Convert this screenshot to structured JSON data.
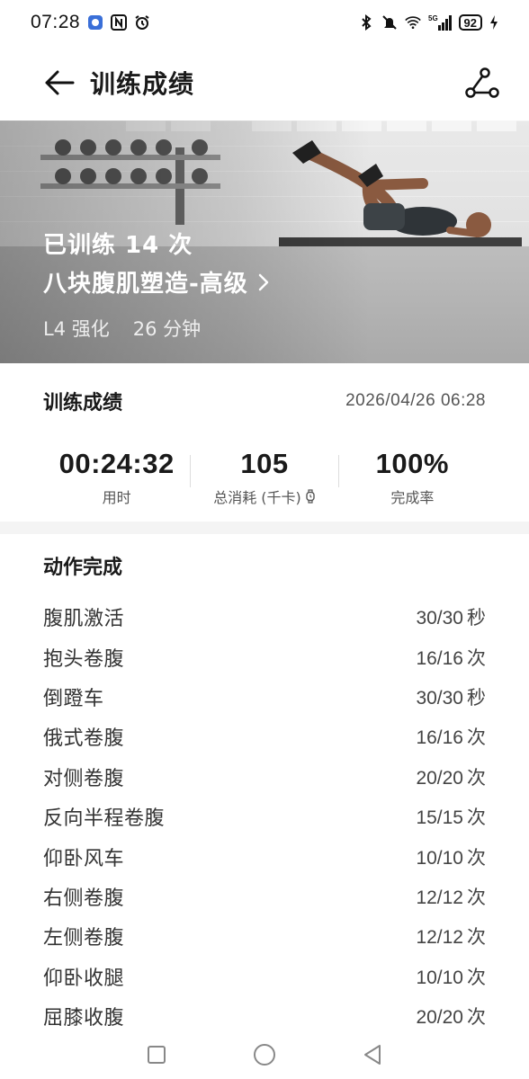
{
  "status_bar": {
    "time": "07:28",
    "battery": "92",
    "network": "5G",
    "left_icons": [
      "app-badge-icon",
      "nfc-icon",
      "alarm-icon"
    ],
    "right_icons": [
      "bluetooth-icon",
      "mute-icon",
      "wifi-icon",
      "signal-icon",
      "battery-icon",
      "charging-icon"
    ]
  },
  "app_bar": {
    "title": "训练成绩",
    "back_icon": "arrow-left-icon",
    "share_icon": "share-icon"
  },
  "hero": {
    "count": "已训练 14 次",
    "course_name": "八块腹肌塑造-高级",
    "level": "L4 强化",
    "duration": "26 分钟"
  },
  "summary": {
    "title": "训练成绩",
    "date": "2026/04/26 06:28",
    "stats": [
      {
        "value": "00:24:32",
        "label": "用时"
      },
      {
        "value": "105",
        "label": "总消耗 (千卡)"
      },
      {
        "value": "100%",
        "label": "完成率"
      }
    ]
  },
  "actions": {
    "title": "动作完成",
    "items": [
      {
        "name": "腹肌激活",
        "value": "30/30",
        "unit": "秒"
      },
      {
        "name": "抱头卷腹",
        "value": "16/16",
        "unit": "次"
      },
      {
        "name": "倒蹬车",
        "value": "30/30",
        "unit": "秒"
      },
      {
        "name": "俄式卷腹",
        "value": "16/16",
        "unit": "次"
      },
      {
        "name": "对侧卷腹",
        "value": "20/20",
        "unit": "次"
      },
      {
        "name": "反向半程卷腹",
        "value": "15/15",
        "unit": "次"
      },
      {
        "name": "仰卧风车",
        "value": "10/10",
        "unit": "次"
      },
      {
        "name": "右侧卷腹",
        "value": "12/12",
        "unit": "次"
      },
      {
        "name": "左侧卷腹",
        "value": "12/12",
        "unit": "次"
      },
      {
        "name": "仰卧收腿",
        "value": "10/10",
        "unit": "次"
      },
      {
        "name": "屈膝收腹",
        "value": "20/20",
        "unit": "次"
      }
    ]
  },
  "nav_bar": {
    "icons": [
      "recents-square-icon",
      "home-circle-icon",
      "back-triangle-icon"
    ]
  }
}
